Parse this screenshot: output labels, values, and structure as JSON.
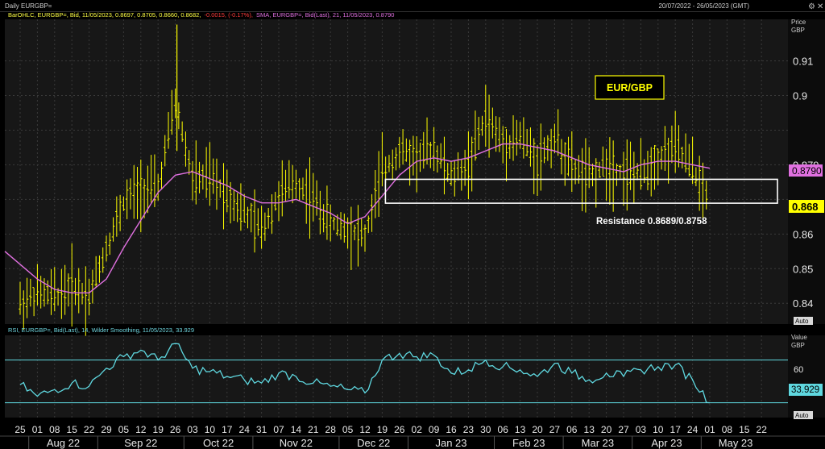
{
  "window": {
    "title": "Daily EURGBP=",
    "date_range": "20/07/2022 - 26/05/2023 (GMT)"
  },
  "colors": {
    "background": "#000000",
    "panel": "#181818",
    "price_bars": "#ffff00",
    "sma_line": "#e070e0",
    "rsi_line": "#5fd8e0",
    "box": "#ffffff"
  },
  "price_panel": {
    "legend_bar": "BarOHLC, EURGBP=, Bid, 11/05/2023, 0.8697, 0.8705, 0.8660, 0.8682,",
    "legend_change": "-0.0015, (-0.17%),",
    "legend_sma": "SMA, EURGBP=, Bid(Last), 21, 11/05/2023, 0.8790",
    "axis_title_1": "Price",
    "axis_title_2": "GBP",
    "auto_label": "Auto",
    "last_price_label": "0.868",
    "sma_label": "0.8790",
    "title_box": "EUR/GBP",
    "resistance_label": "Resistance 0.8689/0.8758"
  },
  "rsi_panel": {
    "legend": "RSI, EURGBP=, Bid(Last), 14, Wilder Smoothing, 11/05/2023, 33.929",
    "axis_title_1": "Value",
    "axis_title_2": "GBP",
    "auto_label": "Auto",
    "value_label": "33.929",
    "tick_label": "60"
  },
  "x_axis": {
    "day_labels": [
      "25",
      "01",
      "08",
      "15",
      "22",
      "29",
      "05",
      "12",
      "19",
      "26",
      "03",
      "10",
      "17",
      "24",
      "31",
      "07",
      "14",
      "21",
      "28",
      "05",
      "12",
      "19",
      "26",
      "02",
      "09",
      "16",
      "23",
      "30",
      "06",
      "13",
      "20",
      "27",
      "06",
      "13",
      "20",
      "27",
      "03",
      "10",
      "17",
      "24",
      "01",
      "08",
      "15",
      "22"
    ],
    "months": [
      "Aug 22",
      "Sep 22",
      "Oct 22",
      "Nov 22",
      "Dec 22",
      "Jan 23",
      "Feb 23",
      "Mar 23",
      "Apr 23",
      "May 23"
    ]
  },
  "chart_data": {
    "type": "line",
    "x_axis": "weekly ticks from 25 Jul 2022 to 22 May 2023",
    "price_ylim": [
      0.834,
      0.922
    ],
    "price_ticks": [
      0.84,
      0.85,
      0.86,
      0.87,
      0.88,
      0.89,
      0.9,
      0.91
    ],
    "price_tick_labels": [
      "0.84",
      "0.85",
      "0.86",
      "",
      "0.879",
      "",
      "0.9",
      "0.91"
    ],
    "resistance": [
      0.8689,
      0.8758
    ],
    "weekly_closes": [
      0.84,
      0.843,
      0.842,
      0.845,
      0.842,
      0.856,
      0.869,
      0.873,
      0.873,
      0.898,
      0.876,
      0.876,
      0.872,
      0.866,
      0.861,
      0.871,
      0.875,
      0.87,
      0.863,
      0.862,
      0.859,
      0.878,
      0.884,
      0.882,
      0.885,
      0.876,
      0.88,
      0.894,
      0.886,
      0.888,
      0.881,
      0.888,
      0.879,
      0.876,
      0.88,
      0.878,
      0.877,
      0.882,
      0.885,
      0.879,
      0.868
    ],
    "sma_weekly": [
      0.855,
      0.847,
      0.844,
      0.843,
      0.843,
      0.847,
      0.856,
      0.864,
      0.872,
      0.877,
      0.878,
      0.876,
      0.874,
      0.871,
      0.869,
      0.869,
      0.87,
      0.868,
      0.866,
      0.863,
      0.865,
      0.871,
      0.877,
      0.881,
      0.882,
      0.881,
      0.882,
      0.884,
      0.886,
      0.886,
      0.885,
      0.884,
      0.882,
      0.88,
      0.879,
      0.878,
      0.88,
      0.881,
      0.881,
      0.88,
      0.879
    ],
    "rsi_weekly": [
      45,
      38,
      42,
      46,
      44,
      55,
      62,
      66,
      60,
      70,
      55,
      53,
      50,
      48,
      46,
      52,
      50,
      46,
      44,
      42,
      40,
      60,
      64,
      62,
      63,
      52,
      54,
      60,
      56,
      54,
      50,
      58,
      52,
      48,
      52,
      50,
      54,
      56,
      57,
      48,
      34
    ],
    "rsi_levels": [
      60,
      34
    ],
    "rsi_ylim": [
      25,
      75
    ]
  }
}
